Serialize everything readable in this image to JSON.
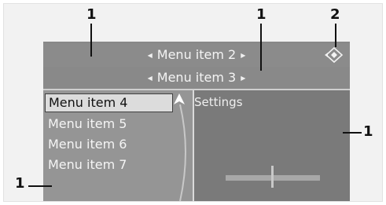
{
  "menu": {
    "item_2": "Menu item 2",
    "item_3": "Menu item 3",
    "left_list": [
      "Menu item 4",
      "Menu item 5",
      "Menu item 6",
      "Menu item 7"
    ]
  },
  "right_panel": {
    "title": "Settings"
  },
  "callouts": {
    "top_left": "1",
    "top_center": "1",
    "top_right": "2",
    "right": "1",
    "left": "1"
  },
  "icons": {
    "nav": "navigation-controller-icon",
    "arrows": "triangle-arrow-icon",
    "pointer": "selection-pointer-icon"
  },
  "colors": {
    "screen": "#888888",
    "selected_item_bg": "#dcdcdc",
    "text": "#f4f4f4",
    "callout": "#111111"
  }
}
